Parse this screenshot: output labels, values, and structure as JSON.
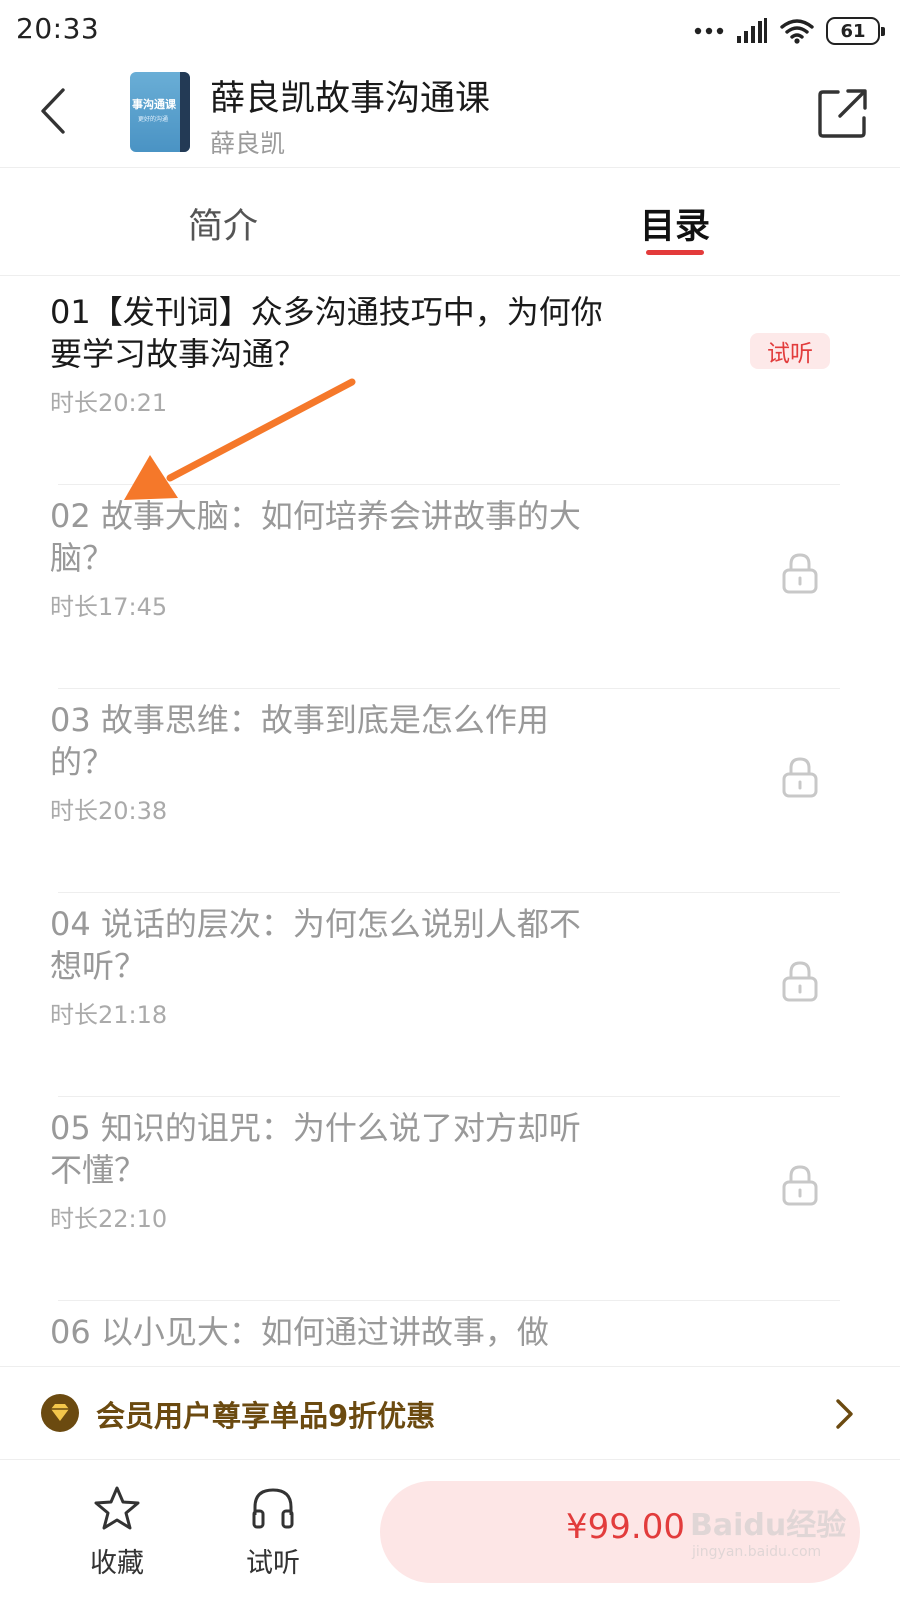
{
  "status_bar": {
    "time": "20:33",
    "battery": "61",
    "icons": [
      "more-dots-icon",
      "signal-icon",
      "wifi-icon",
      "battery-icon"
    ]
  },
  "header": {
    "title": "薛良凯故事沟通课",
    "author": "薛良凯",
    "cover_title": "事沟通课",
    "cover_subtitle": "更好的沟通"
  },
  "tabs": [
    {
      "label": "简介",
      "active": false
    },
    {
      "label": "目录",
      "active": true
    }
  ],
  "lessons": [
    {
      "title": "01【发刊词】众多沟通技巧中，为何你要学习故事沟通？",
      "duration": "时长20:21",
      "locked": false,
      "badge": "试听"
    },
    {
      "title": "02 故事大脑：如何培养会讲故事的大脑？",
      "duration": "时长17:45",
      "locked": true
    },
    {
      "title": "03 故事思维：故事到底是怎么作用的？",
      "duration": "时长20:38",
      "locked": true
    },
    {
      "title": "04 说话的层次：为何怎么说别人都不想听？",
      "duration": "时长21:18",
      "locked": true
    },
    {
      "title": "05 知识的诅咒：为什么说了对方却听不懂？",
      "duration": "时长22:10",
      "locked": true
    },
    {
      "title": "06 以小见大：如何通过讲故事，做",
      "duration": "",
      "locked": true
    }
  ],
  "member_bar": {
    "text": "会员用户尊享单品9折优惠"
  },
  "bottom_bar": {
    "favorite_label": "收藏",
    "listen_label": "试听",
    "price": "¥99.00"
  },
  "watermark": {
    "main": "Baidu经验",
    "sub": "jingyan.baidu.com"
  },
  "colors": {
    "accent_red": "#e33b3b",
    "badge_bg": "#fde9e9",
    "member_gold": "#6b4a10",
    "annotation_orange": "#f5782a"
  }
}
